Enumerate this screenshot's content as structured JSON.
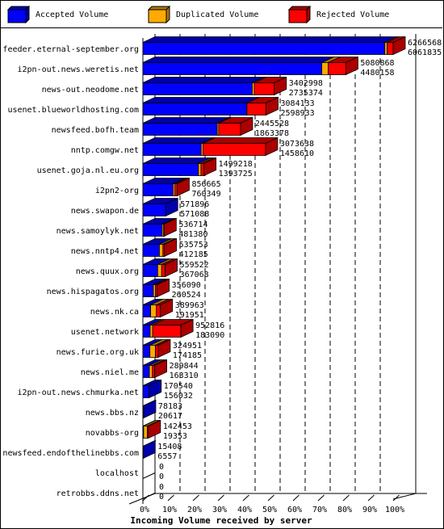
{
  "chart_data": {
    "type": "bar",
    "orientation": "horizontal",
    "stacked": true,
    "title": "",
    "xlabel": "Incoming Volume received by server",
    "ylabel": "",
    "xlim": [
      0,
      100
    ],
    "x_unit": "%",
    "x_ticks": [
      "0%",
      "10%",
      "20%",
      "30%",
      "40%",
      "50%",
      "60%",
      "70%",
      "80%",
      "90%",
      "100%"
    ],
    "grid": true,
    "legend_position": "top",
    "legend": [
      {
        "name": "Accepted Volume",
        "color": "#0000ff"
      },
      {
        "name": "Duplicated Volume",
        "color": "#ffaa00"
      },
      {
        "name": "Rejected Volume",
        "color": "#ff0000"
      }
    ],
    "categories": [
      "feeder.eternal-september.org",
      "i2pn-out.news.weretis.net",
      "news-out.neodome.net",
      "usenet.blueworldhosting.com",
      "newsfeed.bofh.team",
      "nntp.comgw.net",
      "usenet.goja.nl.eu.org",
      "i2pn2-org",
      "news.swapon.de",
      "news.samoylyk.net",
      "news.nntp4.net",
      "news.quux.org",
      "news.hispagatos.org",
      "news.nk.ca",
      "usenet.network",
      "news.furie.org.uk",
      "news.niel.me",
      "i2pn-out.news.chmurka.net",
      "news.bbs.nz",
      "novabbs-org",
      "newsfeed.endofthelinebbs.com",
      "localhost",
      "retrobbs.ddns.net"
    ],
    "total_volume": [
      6266568,
      5080868,
      3402998,
      3084133,
      2445528,
      3073638,
      1499218,
      856665,
      571896,
      536714,
      535753,
      559522,
      356090,
      389963,
      952816,
      324951,
      289844,
      170540,
      78183,
      142453,
      15408,
      0,
      0
    ],
    "accepted_volume": [
      6061835,
      4480158,
      2735374,
      2598933,
      1863378,
      1458610,
      1393725,
      760349,
      571088,
      481380,
      412185,
      367068,
      260524,
      191951,
      183090,
      174185,
      163310,
      156032,
      20617,
      19353,
      6557,
      0,
      0
    ],
    "series": [
      {
        "name": "Accepted Volume",
        "values_pct": [
          96.7,
          71.5,
          43.7,
          41.5,
          29.7,
          23.3,
          22.2,
          12.1,
          9.1,
          7.7,
          6.6,
          5.9,
          4.2,
          3.1,
          2.9,
          2.8,
          2.6,
          2.5,
          0.3,
          0.3,
          0.1,
          0,
          0
        ]
      },
      {
        "name": "Duplicated Volume",
        "values_pct": [
          0.9,
          2.5,
          0.8,
          0.1,
          0.6,
          0.7,
          1.0,
          0.7,
          0,
          0.6,
          1.4,
          1.6,
          0.8,
          2.3,
          1.0,
          2.2,
          1.2,
          0,
          0,
          1.5,
          0,
          0,
          0
        ]
      },
      {
        "name": "Rejected Volume",
        "values_pct": [
          2.4,
          7.1,
          8.0,
          7.6,
          8.7,
          25.0,
          1.2,
          0.9,
          0,
          0.2,
          0.6,
          1.4,
          0.7,
          1.6,
          11.3,
          1.1,
          0.9,
          0,
          0,
          0.4,
          0,
          0,
          0
        ]
      }
    ]
  }
}
